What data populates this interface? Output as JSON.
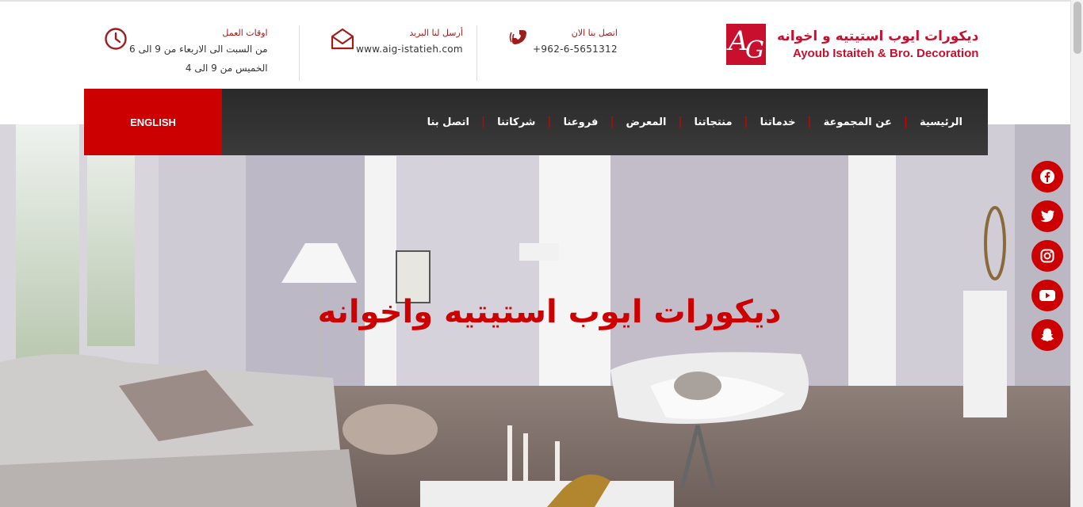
{
  "brand": {
    "logo_mark": "AiG",
    "name_ar": "ديكورات ايوب استيتيه و اخوانه",
    "name_en": "Ayoub Istaiteh & Bro. Decoration"
  },
  "contact": {
    "phone": {
      "title": "اتصل بنا الان",
      "value": "+962-6-5651312",
      "icon": "phone-icon"
    },
    "email": {
      "title": "أرسل لنا البريد",
      "value": "www.aig-istatieh.com",
      "icon": "envelope-icon"
    },
    "hours": {
      "title": "اوقات العمل",
      "line1": "من السبت الى الاربعاء من 9 الى 6",
      "line2": "الخميس من 9 الى 4",
      "icon": "clock-icon"
    }
  },
  "nav": {
    "language": "ENGLISH",
    "items": [
      "الرئيسية",
      "عن المجموعة",
      "خدماتنا",
      "منتجاتنا",
      "المعرض",
      "فروعنا",
      "شركاتنا",
      "اتصل بنا"
    ]
  },
  "hero": {
    "title": "ديكورات ايوب استيتيه واخوانه"
  },
  "social": [
    "facebook-icon",
    "twitter-icon",
    "instagram-icon",
    "youtube-icon",
    "snapchat-icon"
  ],
  "colors": {
    "accent": "#c00000",
    "nav_bg": "#333333"
  }
}
